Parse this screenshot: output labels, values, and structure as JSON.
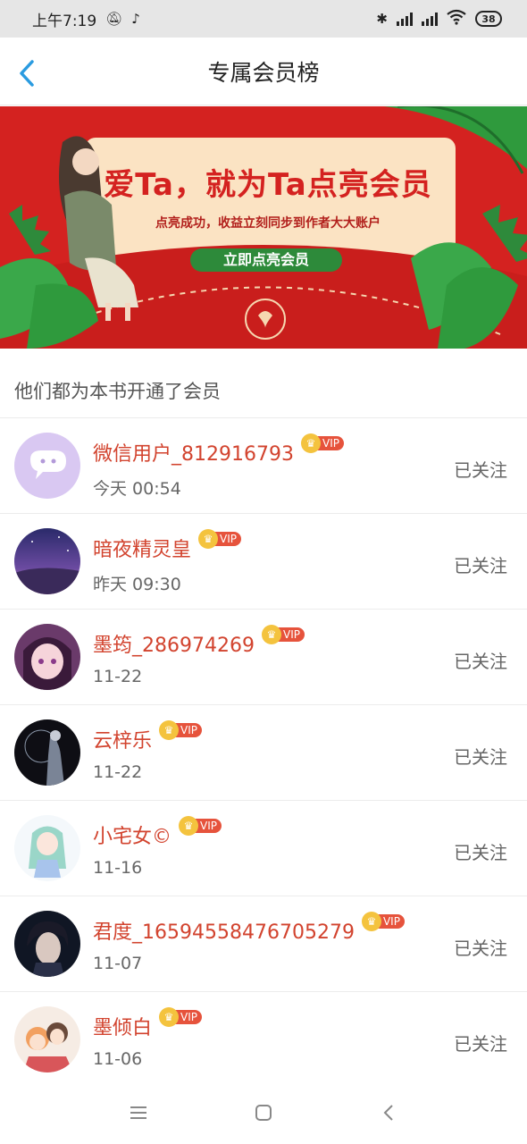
{
  "status_bar": {
    "time": "上午7:19",
    "battery": "38"
  },
  "header": {
    "title": "专属会员榜"
  },
  "banner": {
    "title": "爱Ta，就为Ta点亮会员",
    "subtitle": "点亮成功，收益立刻同步到作者大大账户",
    "button_label": "立即点亮会员"
  },
  "section": {
    "label": "他们都为本书开通了会员"
  },
  "vip_label": "VIP",
  "members": [
    {
      "name": "微信用户_812916793",
      "time": "今天 00:54",
      "follow_label": "已关注",
      "avatar": "wechat-avatar"
    },
    {
      "name": "暗夜精灵皇",
      "time": "昨天 09:30",
      "follow_label": "已关注",
      "avatar": "night-sky-avatar"
    },
    {
      "name": "墨筠_286974269",
      "time": "11-22",
      "follow_label": "已关注",
      "avatar": "anime-girl-avatar"
    },
    {
      "name": "云梓乐",
      "time": "11-22",
      "follow_label": "已关注",
      "avatar": "dark-figure-avatar"
    },
    {
      "name": "小宅女©",
      "time": "11-16",
      "follow_label": "已关注",
      "avatar": "chibi-girl-avatar"
    },
    {
      "name": "君度_16594558476705279",
      "time": "11-07",
      "follow_label": "已关注",
      "avatar": "anime-boy-avatar"
    },
    {
      "name": "墨倾白",
      "time": "11-06",
      "follow_label": "已关注",
      "avatar": "couple-avatar"
    }
  ],
  "colors": {
    "accent": "#2a9be0",
    "name": "#d2432e",
    "banner_red": "#d42220",
    "vip_tag": "#e6533c",
    "crown": "#f4c33e"
  }
}
